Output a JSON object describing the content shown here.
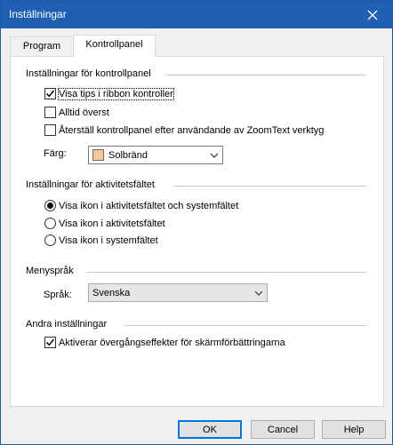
{
  "window": {
    "title": "Inställningar"
  },
  "tabs": [
    {
      "label": "Program"
    },
    {
      "label": "Kontrollpanel"
    }
  ],
  "control_panel": {
    "title": "Inställningar för kontrollpanel",
    "show_tips": {
      "label": "Visa tips i ribbon kontroller",
      "checked": true
    },
    "always_on_top": {
      "label": "Alltid överst",
      "checked": false
    },
    "restore": {
      "label": "Återställ kontrollpanel efter användande av ZoomText verktyg",
      "checked": false
    },
    "color_label": "Färg:",
    "color_value": "Solbränd",
    "color_swatch": "#f8c89b"
  },
  "taskbar": {
    "title": "Inställningar för aktivitetsfältet",
    "options": [
      {
        "label": "Visa ikon i aktivitetsfältet och systemfältet",
        "selected": true
      },
      {
        "label": "Visa ikon i aktivitetsfältet",
        "selected": false
      },
      {
        "label": "Visa ikon i systemfältet",
        "selected": false
      }
    ]
  },
  "menu_language": {
    "title": "Menyspråk",
    "language_label": "Språk:",
    "language_value": "Svenska"
  },
  "other": {
    "title": "Andra inställningar",
    "transitions": {
      "label": "Aktiverar övergångseffekter för skärmförbättringarna",
      "checked": true
    }
  },
  "buttons": {
    "ok": "OK",
    "cancel": "Cancel",
    "help": "Help"
  },
  "colors": {
    "titlebar": "#1f5fb4",
    "accent": "#0078d7"
  }
}
